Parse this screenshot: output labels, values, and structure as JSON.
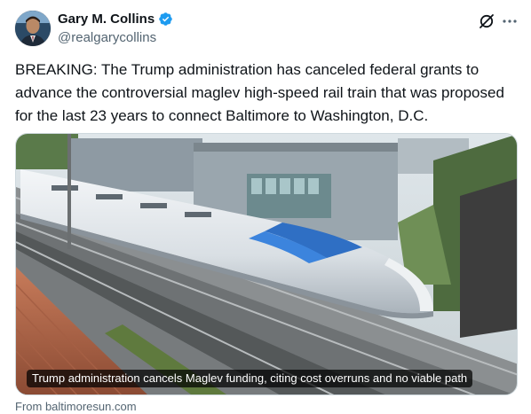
{
  "author": {
    "display_name": "Gary M. Collins",
    "handle": "@realgarycollins",
    "verified": true,
    "verified_badge_color": "#1d9bf0"
  },
  "header_icons": {
    "grok_icon": "grok-icon",
    "more_icon": "more-options-icon"
  },
  "tweet": {
    "text": "BREAKING: The Trump administration has canceled federal grants to advance the controversial maglev high-speed rail train that was proposed for the last 23 years to connect Baltimore to Washington, D.C."
  },
  "media": {
    "caption": "Trump administration cancels Maglev funding, citing cost overruns and no viable path"
  },
  "link_card": {
    "source": "From baltimoresun.com"
  }
}
